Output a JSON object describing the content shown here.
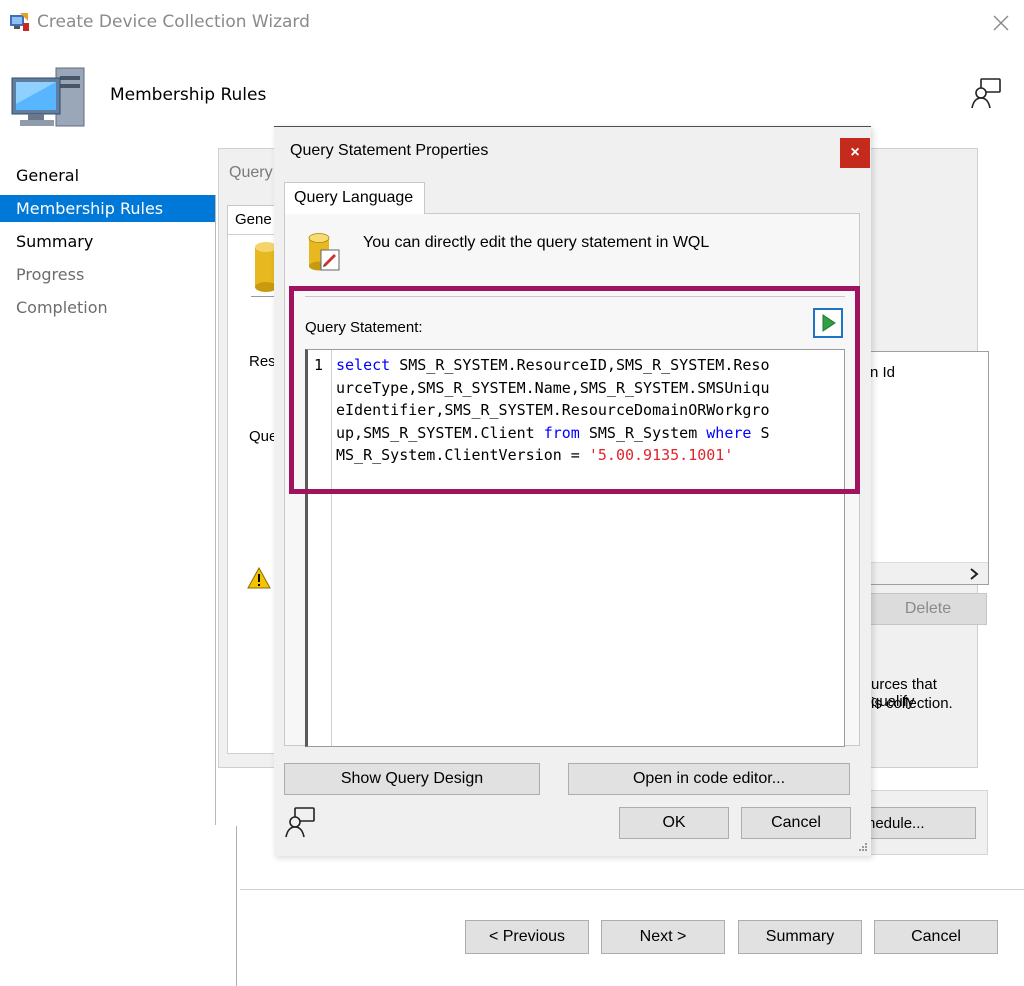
{
  "window": {
    "title": "Create Device Collection Wizard",
    "page_heading": "Membership Rules"
  },
  "nav": {
    "items": [
      {
        "label": "General",
        "state": "done"
      },
      {
        "label": "Membership Rules",
        "state": "active"
      },
      {
        "label": "Summary",
        "state": "done"
      },
      {
        "label": "Progress",
        "state": "pending"
      },
      {
        "label": "Completion",
        "state": "pending"
      }
    ]
  },
  "background_panel": {
    "tab_fragment_top": "Query",
    "tab_fragment_general": "Gene",
    "label_res": "Res",
    "label_que": "Que",
    "column_header_fragment": "n Id",
    "delete_label": "Delete",
    "info_line1": "urces that qualify",
    "info_line2": "is collection.",
    "schedule_fragment": "hedule..."
  },
  "dialog": {
    "title": "Query Statement Properties",
    "close_glyph": "×",
    "tab_label": "Query Language",
    "info_text": "You can directly edit the query statement in WQL",
    "section_label": "Query Statement:",
    "line_number": "1",
    "code": {
      "t1": "select",
      "t2": " SMS_R_SYSTEM.ResourceID,SMS_R_SYSTEM.Reso",
      "t3": "urceType,SMS_R_SYSTEM.Name,SMS_R_SYSTEM.SMSUniqu",
      "t4": "eIdentifier,SMS_R_SYSTEM.ResourceDomainORWorkgro",
      "t5": "up,SMS_R_SYSTEM.Client ",
      "t6": "from",
      "t7": " SMS_R_System ",
      "t8": "where",
      "t9": " S",
      "t10": "MS_R_System.ClientVersion = ",
      "t11": "'5.00.9135.1001'"
    },
    "show_query_design_label": "Show Query Design",
    "open_code_editor_label": "Open in code editor...",
    "ok_label": "OK",
    "cancel_label": "Cancel"
  },
  "footer": {
    "previous_label": "< Previous",
    "next_label": "Next >",
    "summary_label": "Summary",
    "cancel_label": "Cancel"
  },
  "colors": {
    "nav_active_bg": "#0078d7",
    "highlight_border": "#a0135f",
    "close_button_bg": "#c42b1c",
    "keyword": "#0000ff",
    "string": "#e0242c"
  }
}
